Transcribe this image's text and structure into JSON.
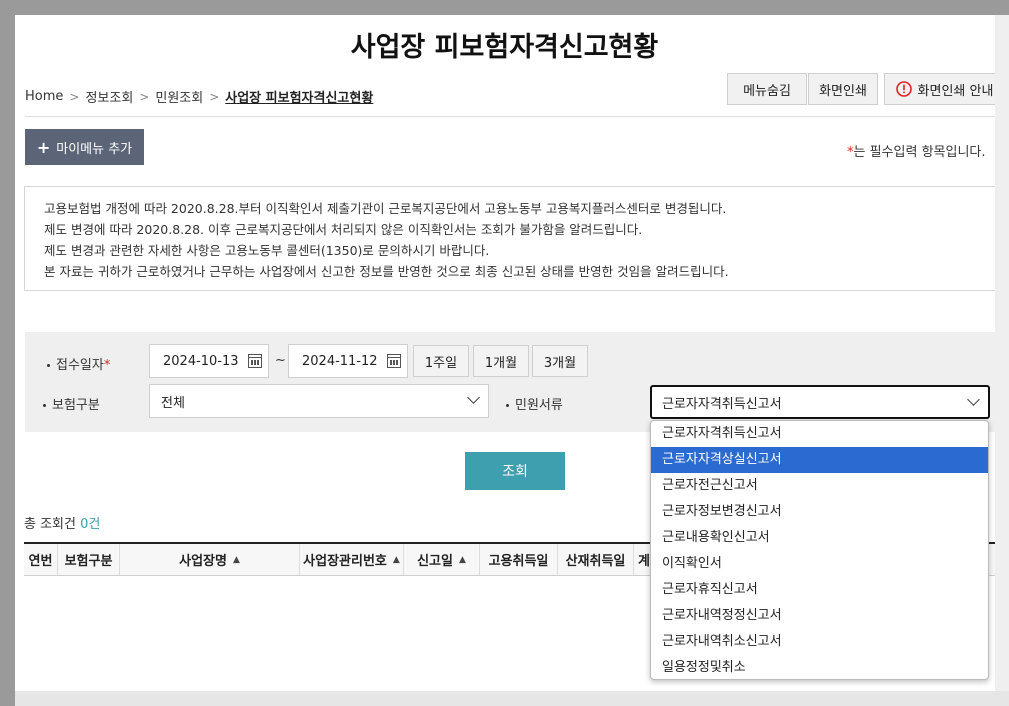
{
  "page_title": "사업장 피보험자격신고현황",
  "breadcrumb": [
    "Home",
    "정보조회",
    "민원조회",
    "사업장 피보험자격신고현황"
  ],
  "top_buttons": {
    "hide_menu": "메뉴숨김",
    "print": "화면인쇄",
    "print_guide": "화면인쇄 안내"
  },
  "add_menu": {
    "icon": "plus-icon",
    "label": "마이메뉴 추가"
  },
  "required_note": {
    "star": "*",
    "text": "는 필수입력 항목입니다."
  },
  "notice": [
    "고용보험법 개정에 따라 2020.8.28.부터 이직확인서 제출기관이 근로복지공단에서 고용노동부 고용복지플러스센터로 변경됩니다.",
    "제도 변경에 따라 2020.8.28. 이후 근로복지공단에서 처리되지 않은 이직확인서는 조회가 불가함을 알려드립니다.",
    "제도 변경과 관련한 자세한 사항은 고용노동부 콜센터(1350)로 문의하시기 바랍니다.",
    "본 자료는 귀하가 근로하였거나 근무하는 사업장에서 신고한 정보를 반영한 것으로 최종 신고된 상태를 반영한 것임을 알려드립니다."
  ],
  "search": {
    "receipt_date_label": "접수일자",
    "receipt_required": "*",
    "date_from": "2024-10-13",
    "tilde": "~",
    "date_to": "2024-11-12",
    "period_buttons": [
      "1주일",
      "1개월",
      "3개월"
    ],
    "insurance_type_label": "보험구분",
    "insurance_type_value": "전체",
    "document_label": "민원서류",
    "document_value": "근로자자격취득신고서"
  },
  "query_button": "조회",
  "total": {
    "label": "총 조회건",
    "count": "0건"
  },
  "table_headers": [
    "연번",
    "보험구분",
    "사업장명",
    "사업장관리번호",
    "신고일",
    "고용취득일",
    "산재취득일",
    "계"
  ],
  "dropdown_options": [
    "근로자자격취득신고서",
    "근로자자격상실신고서",
    "근로자전근신고서",
    "근로자정보변경신고서",
    "근로내용확인신고서",
    "이직확인서",
    "근로자휴직신고서",
    "근로자내역정정신고서",
    "근로자내역취소신고서",
    "일용정정및취소"
  ],
  "highlighted_option_index": 1,
  "accent_color": "#3e9fae",
  "highlight_color": "#2b6bd1"
}
